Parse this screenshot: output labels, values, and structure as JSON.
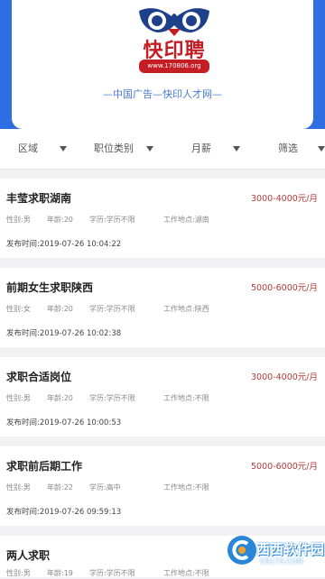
{
  "brand": {
    "logo_text": "快印聘",
    "logo_url": "www.170806.org",
    "slogan": "—中国广告—快印人才网—"
  },
  "filters": [
    {
      "label": "区域"
    },
    {
      "label": "职位类别"
    },
    {
      "label": "月薪"
    },
    {
      "label": "筛选"
    }
  ],
  "jobs": [
    {
      "title": "丰莹求职湖南",
      "salary": "3000-4000元/月",
      "gender": "性别:男",
      "age": "年龄:20",
      "education": "学历:学历不限",
      "location": "工作地点:湖南",
      "time": "发布时间:2019-07-26 10:04:22"
    },
    {
      "title": "前期女生求职陕西",
      "salary": "5000-6000元/月",
      "gender": "性别:女",
      "age": "年龄:20",
      "education": "学历:学历不限",
      "location": "工作地点:陕西",
      "time": "发布时间:2019-07-26 10:02:38"
    },
    {
      "title": "求职合适岗位",
      "salary": "3000-4000元/月",
      "gender": "性别:男",
      "age": "年龄:20",
      "education": "学历:学历不限",
      "location": "工作地点:不限",
      "time": "发布时间:2019-07-26 10:00:53"
    },
    {
      "title": "求职前后期工作",
      "salary": "5000-6000元/月",
      "gender": "性别:男",
      "age": "年龄:22",
      "education": "学历:高中",
      "location": "工作地点:不限",
      "time": "发布时间:2019-07-26 09:59:13"
    },
    {
      "title": "两人求职",
      "salary": "",
      "gender": "性别:男",
      "age": "年龄:19",
      "education": "学历:学历不限",
      "location": "工作地点:不限",
      "time": ""
    }
  ],
  "watermark": {
    "text": "西西软件园",
    "url": "CR173.COM"
  },
  "colors": {
    "accent_blue": "#2f6de3",
    "salary_red": "#b23a3a",
    "logo_red": "#c41d24"
  },
  "icons": {
    "logo": "owl-eyes-logo",
    "filter_caret": "caret-down-icon",
    "watermark": "cr-logo-icon"
  }
}
